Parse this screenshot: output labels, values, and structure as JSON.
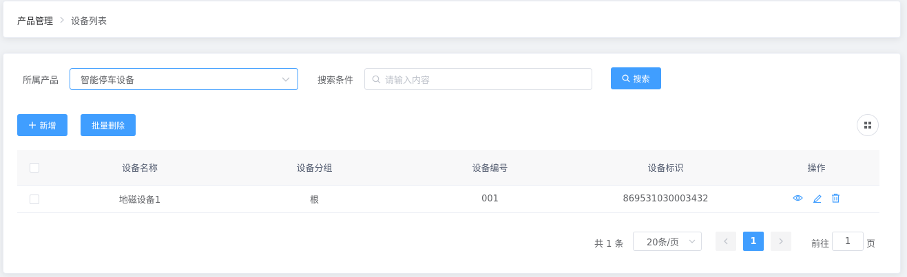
{
  "breadcrumb": {
    "items": [
      "产品管理",
      "设备列表"
    ],
    "separator": ">"
  },
  "filters": {
    "product_label": "所属产品",
    "product_value": "智能停车设备",
    "search_label": "搜索条件",
    "search_placeholder": "请输入内容",
    "search_button": "搜索"
  },
  "actions": {
    "add_label": "新增",
    "batch_delete_label": "批量删除"
  },
  "table": {
    "headers": {
      "name": "设备名称",
      "group": "设备分组",
      "no": "设备编号",
      "id": "设备标识",
      "ops": "操作"
    },
    "rows": [
      {
        "name": "地磁设备1",
        "group": "根",
        "no": "001",
        "id": "869531030003432"
      }
    ]
  },
  "pagination": {
    "total": "共 1 条",
    "page_size": "20条/页",
    "current_page": "1",
    "goto_prefix": "前往",
    "goto_value": "1",
    "goto_suffix": "页"
  },
  "colors": {
    "primary": "#409eff",
    "border": "#dcdfe6",
    "header_bg": "#f8f8f9"
  },
  "icons": [
    "chevron-right-icon",
    "chevron-down-icon",
    "search-icon",
    "plus-icon",
    "grid-icon",
    "eye-icon",
    "edit-icon",
    "delete-icon",
    "chevron-left-icon"
  ]
}
